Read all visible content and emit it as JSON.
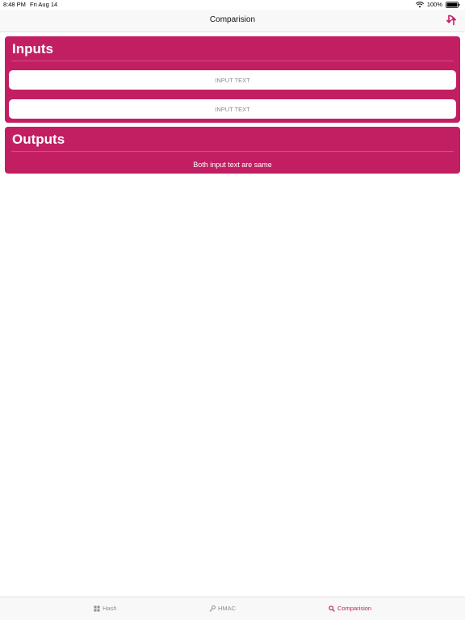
{
  "status_bar": {
    "time": "8:48 PM",
    "date": "Fri Aug 14",
    "battery": "100%"
  },
  "nav": {
    "title": "Comparision",
    "swap_icon": "arrow-swap-icon"
  },
  "inputs_card": {
    "title": "Inputs",
    "input1_placeholder": "INPUT TEXT",
    "input2_placeholder": "INPUT TEXT"
  },
  "outputs_card": {
    "title": "Outputs",
    "result": "Both input text are same"
  },
  "tabs": [
    {
      "label": "Hash",
      "icon": "grid-icon",
      "selected": false
    },
    {
      "label": "HMAC",
      "icon": "key-icon",
      "selected": false
    },
    {
      "label": "Comparision",
      "icon": "magnifier-icon",
      "selected": true
    }
  ],
  "colors": {
    "accent": "#c21f63",
    "tab_inactive": "#8e8e8e",
    "bar_background": "#f8f8f8"
  }
}
